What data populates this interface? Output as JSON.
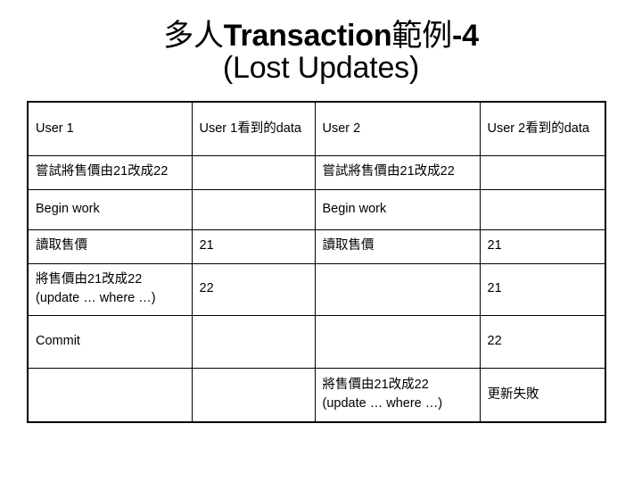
{
  "slide": {
    "title_line_1_cjk_prefix": "多人",
    "title_line_1_latin": "Transaction",
    "title_line_1_cjk_suffix": "範例",
    "title_line_1_tail": "-4",
    "title_line_2": "(Lost Updates)",
    "background_color": "#ffffff",
    "text_color": "#000000",
    "border_color": "#000000"
  },
  "table": {
    "headers": [
      "User 1",
      "User 1看到的data",
      "User 2",
      "User 2看到的data"
    ],
    "rows": [
      {
        "user1_action": "嘗試將售價由21改成22",
        "user1_data": "",
        "user2_action": "嘗試將售價由21改成22",
        "user2_data": ""
      },
      {
        "user1_action": "Begin work",
        "user1_data": "",
        "user2_action": "Begin work",
        "user2_data": ""
      },
      {
        "user1_action": "讀取售價",
        "user1_data": "21",
        "user2_action": "讀取售價",
        "user2_data": "21"
      },
      {
        "user1_action": "將售價由21改成22\n(update … where …)",
        "user1_data": "22",
        "user2_action": "",
        "user2_data": "21"
      },
      {
        "user1_action": "Commit",
        "user1_data": "",
        "user2_action": "",
        "user2_data": "22"
      },
      {
        "user1_action": "",
        "user1_data": "",
        "user2_action": "將售價由21改成22\n(update … where …)",
        "user2_data": "更新失敗"
      }
    ]
  }
}
